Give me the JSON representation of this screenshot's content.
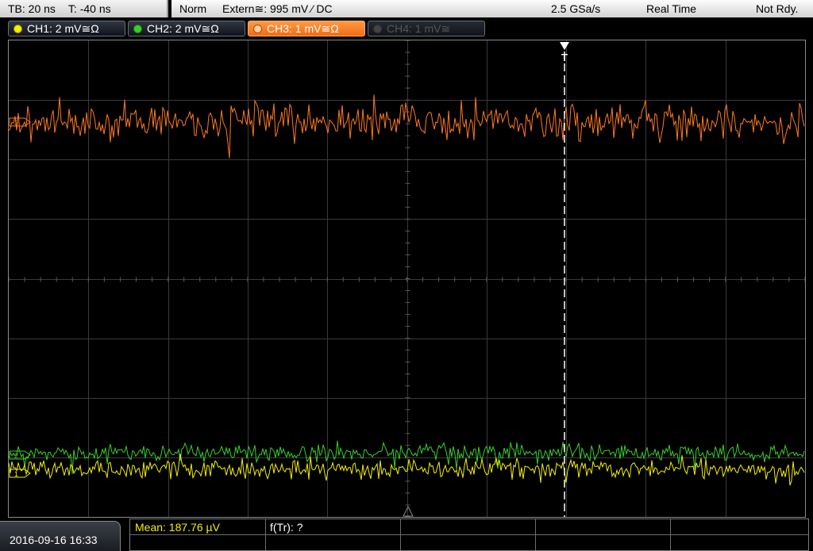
{
  "top_bar": {
    "timebase": "TB: 20 ns",
    "trigger_time": "T: -40 ns",
    "mode": "Norm",
    "trigger_source": "Extern≅: 995 mV ⁄ DC",
    "sample_rate": "2.5 GSa/s",
    "acquisition": "Real Time",
    "status": "Not Rdy."
  },
  "channels": [
    {
      "label": "CH1: 2 mV≅Ω",
      "color": "#f5f000",
      "state": "normal"
    },
    {
      "label": "CH2: 2 mV≅Ω",
      "color": "#37d02a",
      "state": "normal"
    },
    {
      "label": "CH3: 1 mV≅Ω",
      "color": "#ff7a1f",
      "state": "active"
    },
    {
      "label": "CH4: 1 mV≅",
      "color": "#555555",
      "state": "off"
    }
  ],
  "screen": {
    "trigger_marker": "T",
    "markers": {
      "ch3": "3",
      "ch1": "1",
      "ch2": "2"
    }
  },
  "bottom": {
    "datetime": "2016-09-16 16:33",
    "mean": "Mean: 187.76 µV",
    "ftr": "f(Tr): ?"
  },
  "colors": {
    "ch1": "#f5f000",
    "ch2": "#37d02a",
    "ch3": "#ff7a1f",
    "grid": "#3a3a3a",
    "trigger_line": "#ffffff"
  }
}
